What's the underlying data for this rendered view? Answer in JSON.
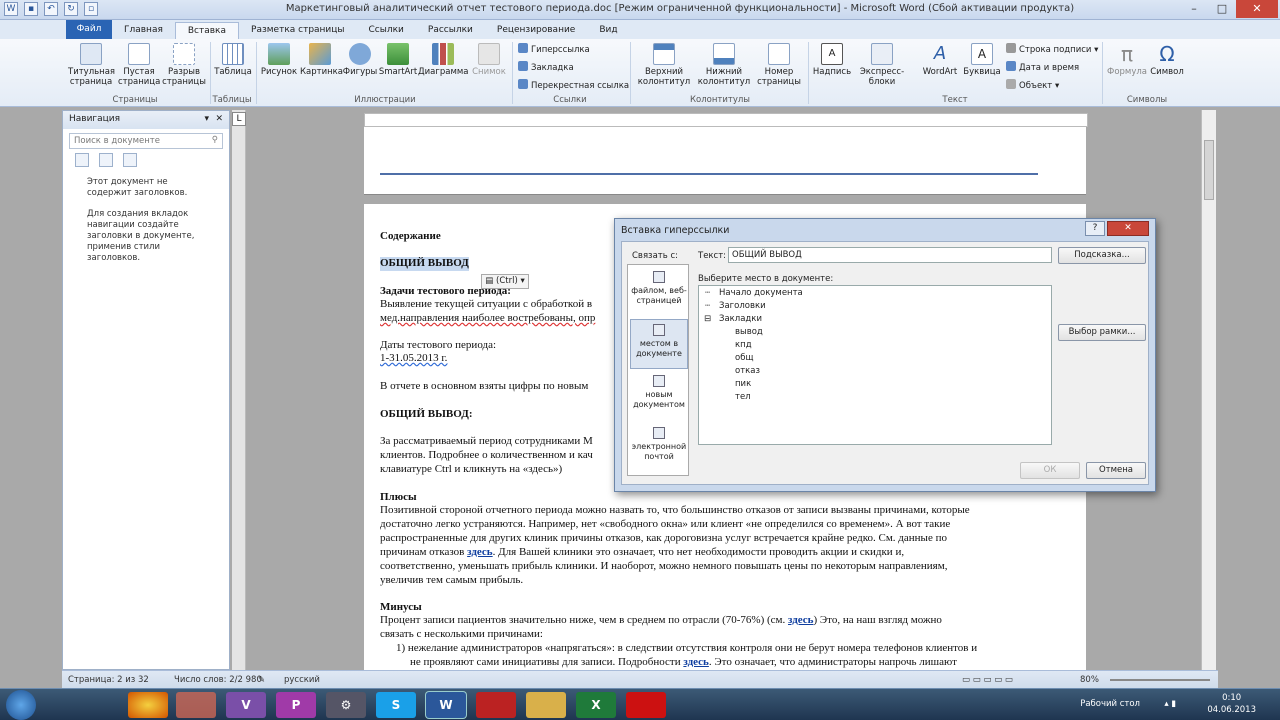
{
  "window": {
    "title": "Маркетинговый аналитический отчет тестового периода.doc [Режим ограниченной функциональности] - Microsoft Word (Сбой активации продукта)"
  },
  "tabs": [
    "Файл",
    "Главная",
    "Вставка",
    "Разметка страницы",
    "Ссылки",
    "Рассылки",
    "Рецензирование",
    "Вид"
  ],
  "active_tab": "Вставка",
  "ribbon": {
    "pages": {
      "title_page": "Титульная страница",
      "blank": "Пустая страница",
      "break": "Разрыв страницы",
      "group": "Страницы"
    },
    "tables": {
      "table": "Таблица",
      "group": "Таблицы"
    },
    "illustrations": {
      "picture": "Рисунок",
      "clipart": "Картинка",
      "shapes": "Фигуры",
      "smartart": "SmartArt",
      "chart": "Диаграмма",
      "snapshot": "Снимок",
      "group": "Иллюстрации"
    },
    "links": {
      "hyperlink": "Гиперссылка",
      "bookmark": "Закладка",
      "crossref": "Перекрестная ссылка",
      "group": "Ссылки"
    },
    "headerfooter": {
      "header": "Верхний колонтитул",
      "footer": "Нижний колонтитул",
      "pagenum": "Номер страницы",
      "group": "Колонтитулы"
    },
    "text": {
      "textbox": "Надпись",
      "quickparts": "Экспресс-блоки",
      "wordart": "WordArt",
      "dropcap": "Буквица",
      "sigline": "Строка подписи",
      "datetime": "Дата и время",
      "object": "Объект",
      "group": "Текст"
    },
    "symbols": {
      "formula": "Формула",
      "symbol": "Символ",
      "group": "Символы"
    }
  },
  "nav": {
    "title": "Навигация",
    "search_placeholder": "Поиск в документе",
    "msg1": "Этот документ не содержит заголовков.",
    "msg2": "Для создания вкладок навигации создайте заголовки в документе, применив стили заголовков."
  },
  "doc": {
    "contents": "Содержание",
    "summary_hl": "ОБЩИЙ ВЫВОД",
    "paste_opt": "(Ctrl)",
    "tasks_h": "Задачи тестового периода:",
    "tasks_1": "Выявление текущей ситуации с обработкой в",
    "tasks_2": "мед.направления наиболее востребованы, опр",
    "dates_h": "Даты тестового периода:",
    "dates_v": "1-31.05.2013 г.",
    "report": "В отчете в основном взяты цифры по новым",
    "summary_h": "ОБЩИЙ ВЫВОД:",
    "sum_1": "За рассматриваемый период сотрудниками М",
    "sum_2": "клиентов. Подробнее о количественном и кач",
    "sum_3": "клавиатуре Ctrl и кликнуть на «здесь»)",
    "plus_h": "Плюсы",
    "plus_1": "Позитивной стороной отчетного периода можно назвать то, что большинство отказов от записи вызваны причинами, которые",
    "plus_2": "достаточно легко устраняются. Например, нет «свободного окна» или клиент «не определился со временем». А вот такие",
    "plus_3": "распространенные для других клиник причины отказов, как дороговизна услуг встречается крайне редко. См. данные по",
    "plus_4a": "причинам отказов ",
    "plus_4link": "здесь",
    "plus_4b": ". Для Вашей клиники это означает, что нет необходимости проводить акции и скидки и,",
    "plus_5": "соответственно, уменьшать прибыль клиники. И наоборот, можно немного повышать цены по некоторым направлениям,",
    "plus_6": "увеличив тем самым прибыль.",
    "minus_h": "Минусы",
    "minus_1a": "Процент записи пациентов значительно ниже, чем в среднем по отрасли (70-76%) (см. ",
    "minus_1link": "здесь",
    "minus_1b": ") Это, на наш взгляд можно",
    "minus_2": "связать с несколькими причинами:",
    "li_1": "1)   нежелание администраторов «напрягаться»: в следствии отсутствия контроля они не берут номера телефонов клиентов  и",
    "li_2a": "не проявляют сами инициативы для записи. Подробности ",
    "li_2link": "здесь",
    "li_2b": ". Это означает, что администраторы напрочь лишают"
  },
  "dialog": {
    "title": "Вставка гиперссылки",
    "link_to": "Связать с:",
    "text_label": "Текст:",
    "text_value": "ОБЩИЙ ВЫВОД",
    "hint_btn": "Подсказка...",
    "place_label": "Выберите место в документе:",
    "frame_btn": "Выбор рамки...",
    "ok": "ОК",
    "cancel": "Отмена",
    "link_options": [
      "файлом, веб-страницей",
      "местом в документе",
      "новым документом",
      "электронной почтой"
    ],
    "tree": [
      "Начало документа",
      "Заголовки",
      "Закладки",
      "вывод",
      "кпд",
      "общ",
      "отказ",
      "пик",
      "тел"
    ]
  },
  "status": {
    "page": "Страница: 2 из 32",
    "words": "Число слов: 2/2 980",
    "lang": "русский",
    "zoom": "80%"
  },
  "taskbar": {
    "desktop": "Рабочий стол",
    "time": "0:10",
    "date": "04.06.2013"
  }
}
